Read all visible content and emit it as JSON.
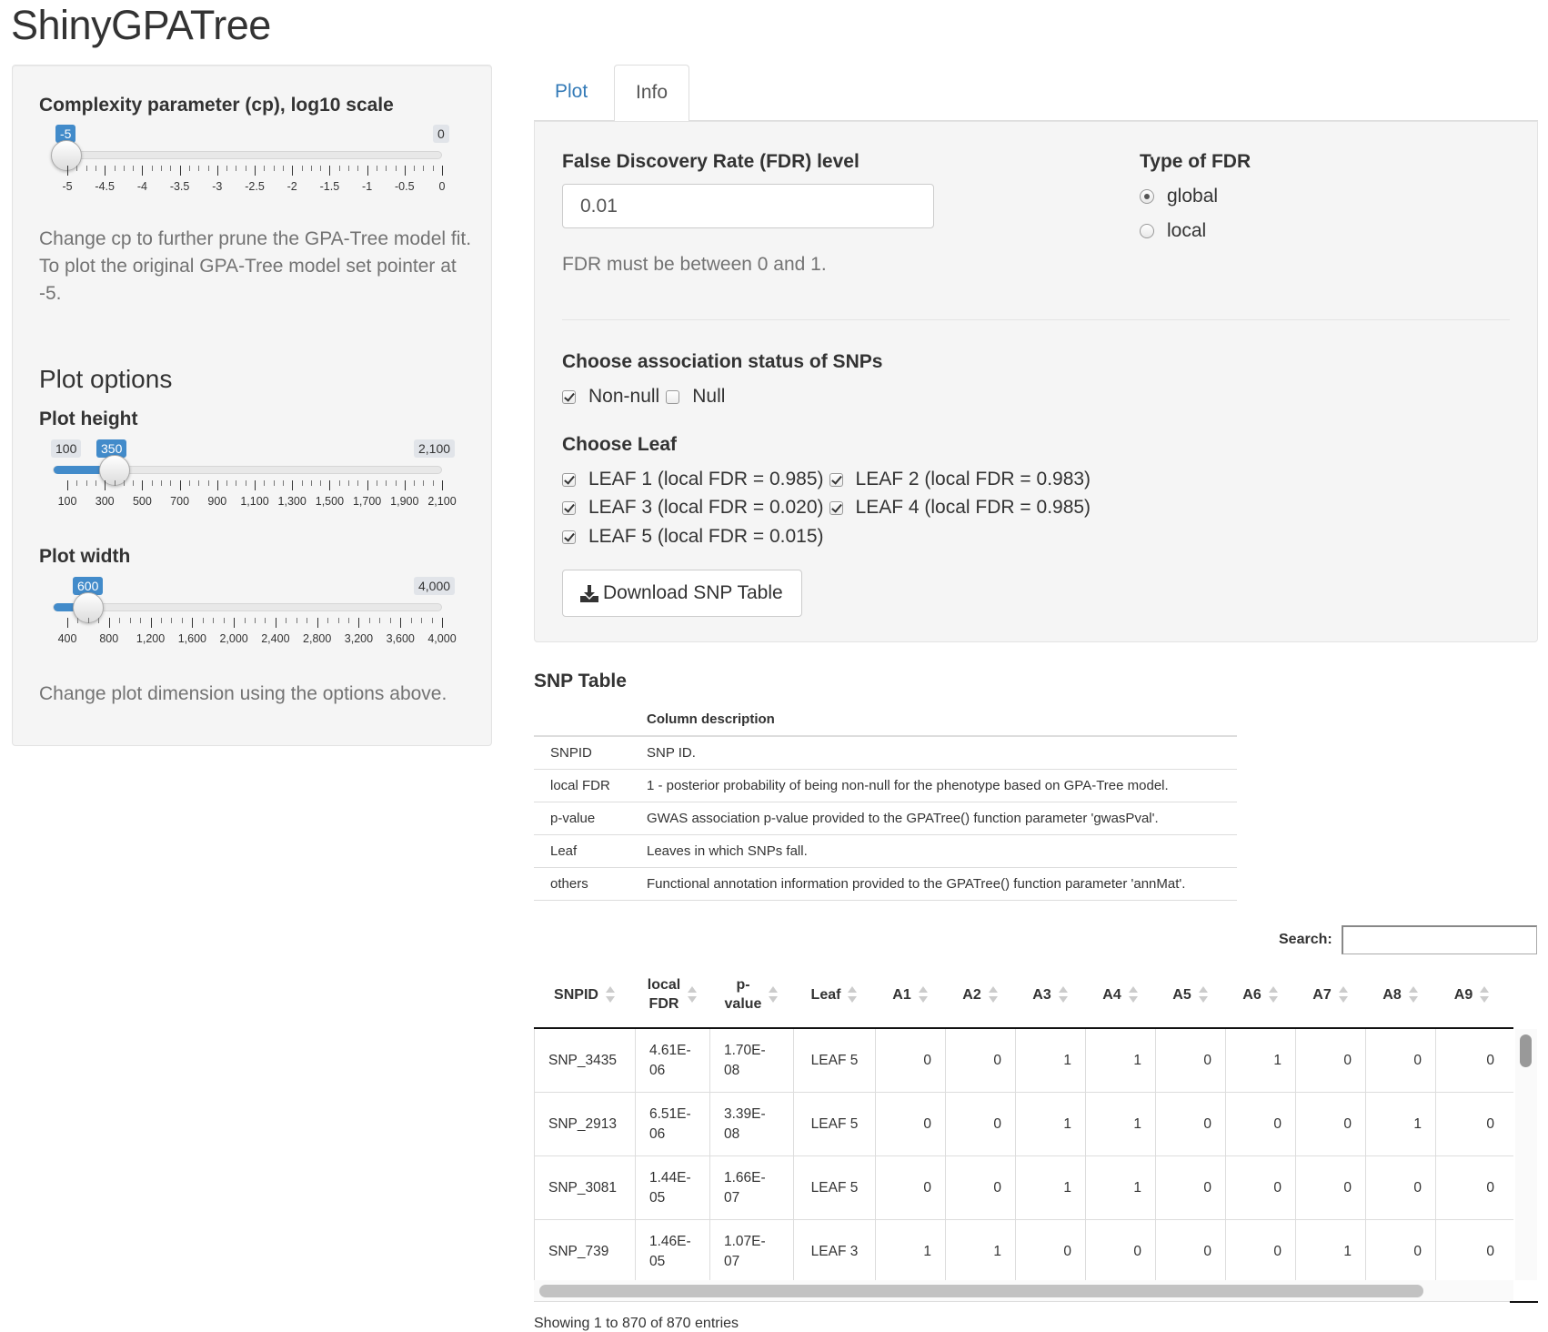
{
  "app": {
    "title": "ShinyGPATree"
  },
  "sidebar": {
    "cp": {
      "label": "Complexity parameter (cp), log10 scale",
      "min_label": "0",
      "value_label": "-5",
      "ticks": [
        "-5",
        "-4.5",
        "-4",
        "-3.5",
        "-3",
        "-2.5",
        "-2",
        "-1.5",
        "-1",
        "-0.5",
        "0"
      ],
      "help": "Change cp to further prune the GPA-Tree model fit. To plot the original GPA-Tree model set pointer at -5."
    },
    "plot_options": {
      "heading": "Plot options"
    },
    "height": {
      "label": "Plot height",
      "min_label": "100",
      "value_label": "350",
      "max_label": "2,100",
      "value": 350,
      "min": 100,
      "max": 2100,
      "ticks": [
        "100",
        "300",
        "500",
        "700",
        "900",
        "1,100",
        "1,300",
        "1,500",
        "1,700",
        "1,900",
        "2,100"
      ]
    },
    "width": {
      "label": "Plot width",
      "value_label": "600",
      "max_label": "4,000",
      "value": 600,
      "min": 400,
      "max": 4000,
      "ticks": [
        "400",
        "800",
        "1,200",
        "1,600",
        "2,000",
        "2,400",
        "2,800",
        "3,200",
        "3,600",
        "4,000"
      ],
      "help": "Change plot dimension using the options above."
    }
  },
  "tabs": [
    {
      "label": "Plot"
    },
    {
      "label": "Info"
    }
  ],
  "panel": {
    "fdr": {
      "label": "False Discovery Rate (FDR) level",
      "value": "0.01",
      "help": "FDR must be between 0 and 1."
    },
    "fdr_type": {
      "label": "Type of FDR",
      "options": [
        "global",
        "local"
      ],
      "selected": "global"
    },
    "assoc": {
      "label": "Choose association status of SNPs",
      "options": [
        "Non-null",
        "Null"
      ]
    },
    "leaf": {
      "label": "Choose Leaf",
      "options": [
        "LEAF 1 (local FDR = 0.985)",
        "LEAF 2 (local FDR = 0.983)",
        "LEAF 3 (local FDR = 0.020)",
        "LEAF 4 (local FDR = 0.985)",
        "LEAF 5 (local FDR = 0.015)"
      ]
    },
    "download": {
      "label": "Download SNP Table"
    }
  },
  "snp_table": {
    "title": "SNP Table",
    "desc_header": "Column description",
    "desc": [
      {
        "col": "SNPID",
        "text": "SNP ID."
      },
      {
        "col": "local FDR",
        "text": "1 - posterior probability of being non-null for the phenotype based on GPA-Tree model."
      },
      {
        "col": "p-value",
        "text": "GWAS association p-value provided to the GPATree() function parameter 'gwasPval'."
      },
      {
        "col": "Leaf",
        "text": "Leaves in which SNPs fall."
      },
      {
        "col": "others",
        "text": "Functional annotation information provided to the GPATree() function parameter 'annMat'."
      }
    ],
    "search_label": "Search:",
    "columns": {
      "snpid": "SNPID",
      "fdr1": "local",
      "fdr2": "FDR",
      "p1": "p-",
      "p2": "value",
      "leaf": "Leaf",
      "a1": "A1",
      "a2": "A2",
      "a3": "A3",
      "a4": "A4",
      "a5": "A5",
      "a6": "A6",
      "a7": "A7",
      "a8": "A8",
      "a9": "A9"
    },
    "rows": [
      {
        "snpid": "SNP_3435",
        "fdr1": "4.61E-",
        "fdr2": "06",
        "p1": "1.70E-",
        "p2": "08",
        "leaf": "LEAF 5",
        "a": [
          "0",
          "0",
          "1",
          "1",
          "0",
          "1",
          "0",
          "0",
          "0"
        ]
      },
      {
        "snpid": "SNP_2913",
        "fdr1": "6.51E-",
        "fdr2": "06",
        "p1": "3.39E-",
        "p2": "08",
        "leaf": "LEAF 5",
        "a": [
          "0",
          "0",
          "1",
          "1",
          "0",
          "0",
          "0",
          "1",
          "0"
        ]
      },
      {
        "snpid": "SNP_3081",
        "fdr1": "1.44E-",
        "fdr2": "05",
        "p1": "1.66E-",
        "p2": "07",
        "leaf": "LEAF 5",
        "a": [
          "0",
          "0",
          "1",
          "1",
          "0",
          "0",
          "0",
          "0",
          "0"
        ]
      },
      {
        "snpid": "SNP_739",
        "fdr1": "1.46E-",
        "fdr2": "05",
        "p1": "1.07E-",
        "p2": "07",
        "leaf": "LEAF 3",
        "a": [
          "1",
          "1",
          "0",
          "0",
          "0",
          "0",
          "1",
          "0",
          "0"
        ]
      }
    ],
    "info": "Showing 1 to 870 of 870 entries"
  },
  "colors": {
    "accent": "#428bca",
    "link": "#337ab7"
  }
}
